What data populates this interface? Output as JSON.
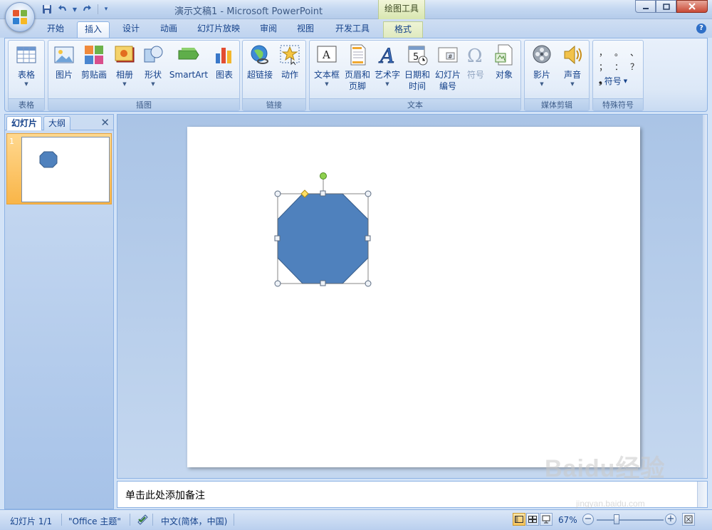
{
  "window": {
    "title": "演示文稿1 - Microsoft PowerPoint",
    "context_tool": "绘图工具"
  },
  "tabs": [
    "开始",
    "插入",
    "设计",
    "动画",
    "幻灯片放映",
    "审阅",
    "视图",
    "开发工具",
    "格式"
  ],
  "active_tab": "插入",
  "ribbon": {
    "groups": {
      "table": {
        "label": "表格",
        "buttons": [
          "表格"
        ]
      },
      "illustrations": {
        "label": "插图",
        "buttons": [
          "图片",
          "剪贴画",
          "相册",
          "形状",
          "SmartArt",
          "图表"
        ]
      },
      "links": {
        "label": "链接",
        "buttons": [
          "超链接",
          "动作"
        ]
      },
      "text": {
        "label": "文本",
        "buttons": [
          {
            "line1": "文本框",
            "line2": ""
          },
          {
            "line1": "页眉和",
            "line2": "页脚"
          },
          {
            "line1": "艺术字",
            "line2": ""
          },
          {
            "line1": "日期和",
            "line2": "时间"
          },
          {
            "line1": "幻灯片",
            "line2": "编号"
          },
          {
            "line1": "符号",
            "line2": ""
          },
          {
            "line1": "对象",
            "line2": ""
          }
        ]
      },
      "media": {
        "label": "媒体剪辑",
        "buttons": [
          "影片",
          "声音"
        ]
      },
      "special": {
        "label": "特殊符号",
        "symbols_row1": [
          "，",
          "。",
          "、"
        ],
        "symbols_row2": [
          "；",
          "：",
          "？"
        ],
        "button": "符号"
      }
    }
  },
  "left_pane": {
    "tabs": [
      "幻灯片",
      "大纲"
    ],
    "slide_number": "1"
  },
  "notes_placeholder": "单击此处添加备注",
  "status": {
    "slide": "幻灯片 1/1",
    "theme": "\"Office 主题\"",
    "language": "中文(简体，中国)",
    "zoom": "67%",
    "zoom_fraction": 0.3
  },
  "watermark": {
    "main": "Baidu经验",
    "sub": "jingyan.baidu.com"
  },
  "colors": {
    "shape_fill": "#4f81bd",
    "shape_stroke": "#385d8a",
    "rotation_handle": "#8fd14f",
    "adjust_handle": "#ffe066"
  }
}
